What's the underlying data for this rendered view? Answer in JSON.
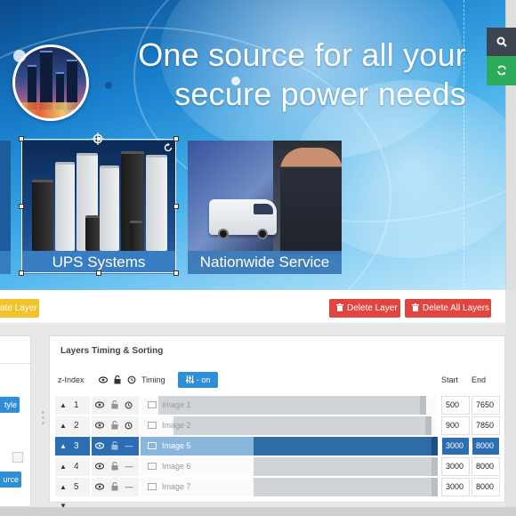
{
  "slide": {
    "headline_line1": "One source for all your",
    "headline_line2": "secure power needs",
    "tiles": [
      {
        "caption": "UPS Systems"
      },
      {
        "caption": "Nationwide Service"
      }
    ]
  },
  "side_buttons": {
    "search_icon": "search-icon",
    "refresh_icon": "refresh-icon",
    "search_color": "#3d4650",
    "refresh_color": "#2cab5a"
  },
  "toolbar": {
    "duplicate_label": "ate Layer",
    "delete_layer_label": "Delete Layer",
    "delete_all_label": "Delete All Layers",
    "duplicate_color": "#f2c22a",
    "delete_color": "#e04540"
  },
  "left_panel": {
    "style_btn_label": "tyle",
    "source_btn_label": "urce"
  },
  "timing": {
    "title": "Layers Timing & Sorting",
    "col_zindex": "z-Index",
    "col_timing": "Timing",
    "toggle_label": "- on",
    "col_start": "Start",
    "col_end": "End",
    "active_color": "#2b6eb3",
    "rows": [
      {
        "z": "1",
        "name": "Image 1",
        "start": "500",
        "end": "7650",
        "active": false,
        "bar_start": 0.06,
        "bar_end": 0.96,
        "has_history": true
      },
      {
        "z": "2",
        "name": "Image 2",
        "start": "900",
        "end": "7850",
        "active": false,
        "bar_start": 0.11,
        "bar_end": 0.98,
        "has_history": true
      },
      {
        "z": "3",
        "name": "Image 5",
        "start": "3000",
        "end": "8000",
        "active": true,
        "bar_start": 0.38,
        "bar_end": 1.0,
        "has_history": false
      },
      {
        "z": "4",
        "name": "Image 6",
        "start": "3000",
        "end": "8000",
        "active": false,
        "bar_start": 0.38,
        "bar_end": 1.0,
        "has_history": false
      },
      {
        "z": "5",
        "name": "Image 7",
        "start": "3000",
        "end": "8000",
        "active": false,
        "bar_start": 0.38,
        "bar_end": 1.0,
        "has_history": false
      }
    ]
  }
}
